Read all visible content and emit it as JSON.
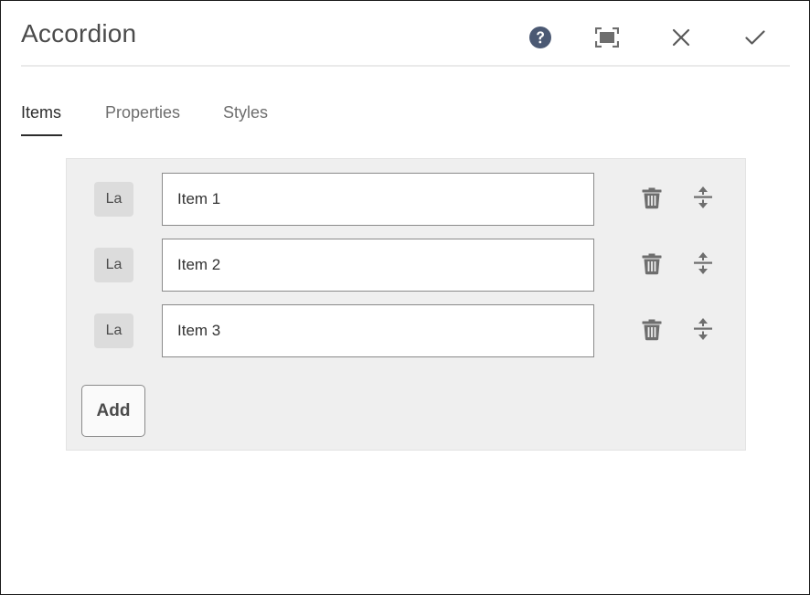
{
  "dialog": {
    "title": "Accordion",
    "actions": {
      "help_icon": "help-icon",
      "fullscreen_icon": "fullscreen-icon",
      "close_icon": "close-icon",
      "confirm_icon": "check-icon"
    }
  },
  "tabs": [
    {
      "label": "Items",
      "selected": true
    },
    {
      "label": "Properties",
      "selected": false
    },
    {
      "label": "Styles",
      "selected": false
    }
  ],
  "items": [
    {
      "language": "La",
      "value": "Item 1"
    },
    {
      "language": "La",
      "value": "Item 2"
    },
    {
      "language": "La",
      "value": "Item 3"
    }
  ],
  "add_label": "Add",
  "colors": {
    "help_icon": "#4b5973",
    "icon_gray": "#6e6e6e",
    "panel_bg": "#efefef",
    "tab_underline": "#2c2c2c"
  }
}
